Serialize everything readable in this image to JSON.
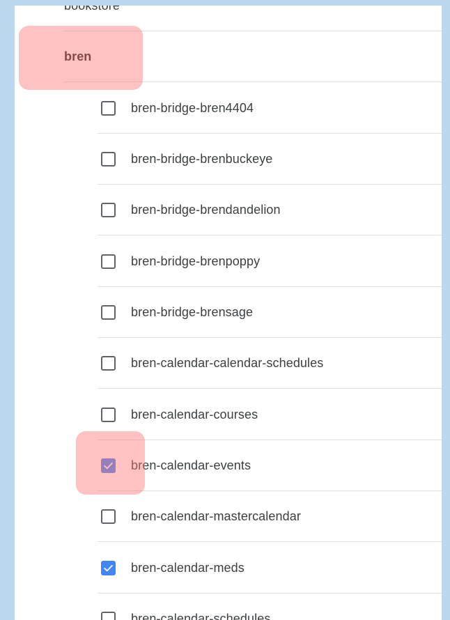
{
  "list": {
    "previous_group": "bookstore",
    "group": {
      "label": "bren"
    },
    "items": [
      {
        "label": "bren-bridge-bren4404",
        "checked": false
      },
      {
        "label": "bren-bridge-brenbuckeye",
        "checked": false
      },
      {
        "label": "bren-bridge-brendandelion",
        "checked": false
      },
      {
        "label": "bren-bridge-brenpoppy",
        "checked": false
      },
      {
        "label": "bren-bridge-brensage",
        "checked": false
      },
      {
        "label": "bren-calendar-calendar-schedules",
        "checked": false
      },
      {
        "label": "bren-calendar-courses",
        "checked": false
      },
      {
        "label": "bren-calendar-events",
        "checked": true
      },
      {
        "label": "bren-calendar-mastercalendar",
        "checked": false
      },
      {
        "label": "bren-calendar-meds",
        "checked": true
      },
      {
        "label": "bren-calendar-schedules",
        "checked": false
      }
    ]
  },
  "colors": {
    "checkbox_checked": "#4285f4",
    "highlight": "#ff7878",
    "background": "#bcd8ef"
  }
}
